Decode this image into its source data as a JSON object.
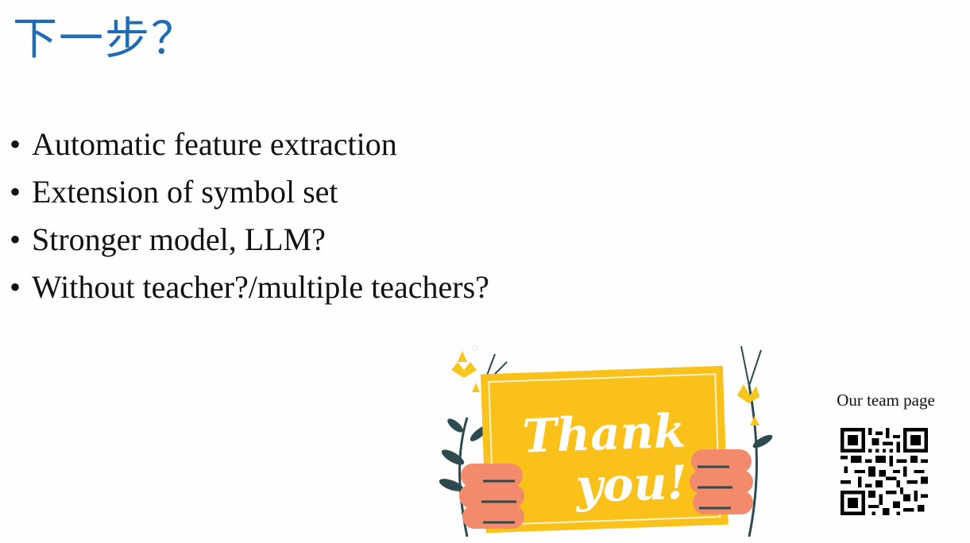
{
  "slide": {
    "title": "下一步？",
    "bullets": [
      "Automatic feature extraction",
      "Extension of symbol set",
      "Stronger model, LLM?",
      "Without teacher?/multiple teachers?"
    ],
    "bullet_symbol": "•",
    "illustration": {
      "line1": "Thank",
      "line2": "you!"
    },
    "qr": {
      "label": "Our team page",
      "icon": "qr-code-icon"
    }
  },
  "colors": {
    "title": "#1f6bb4",
    "card": "#f9c11a",
    "hand": "#f28b6c",
    "leaf": "#2d4a4f",
    "flower": "#f7c51c"
  }
}
